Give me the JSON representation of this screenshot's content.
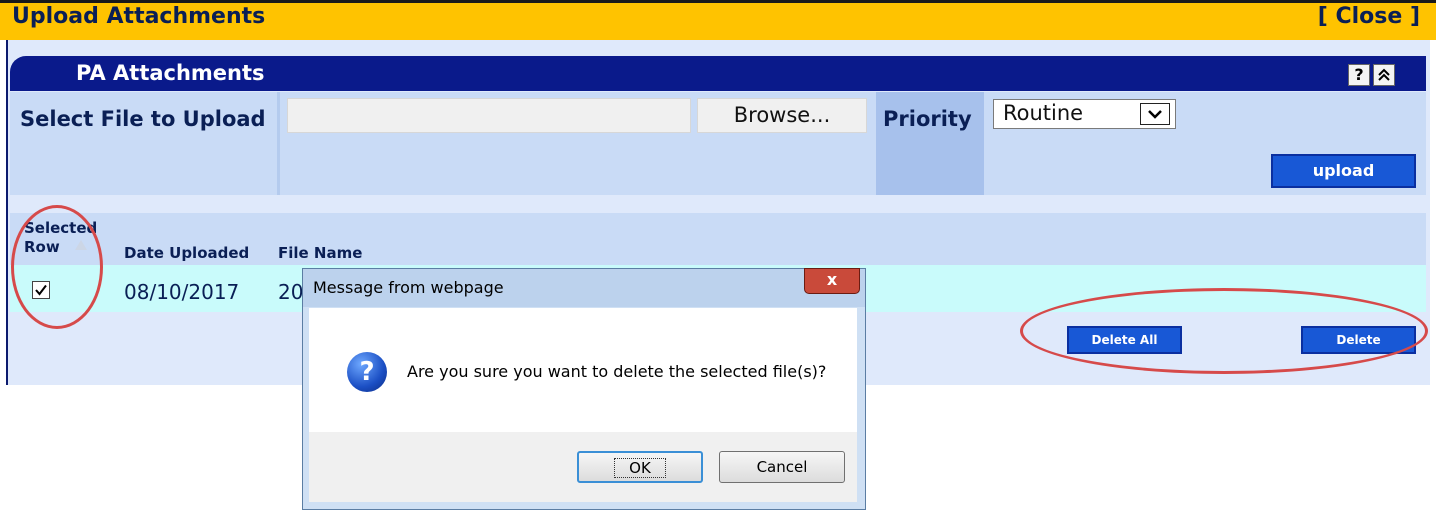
{
  "window": {
    "title": "Upload Attachments",
    "close_label": "[ Close ]"
  },
  "section": {
    "title": "PA Attachments",
    "help_label": "?",
    "collapse_label": "«"
  },
  "upload_form": {
    "file_label": "Select File to Upload",
    "file_value": "",
    "browse_label": "Browse...",
    "priority_label": "Priority",
    "priority_selected": "Routine",
    "upload_label": "upload"
  },
  "table": {
    "headers": {
      "selected_row": "Selected Row",
      "date_uploaded": "Date Uploaded",
      "file_name": "File Name"
    },
    "rows": [
      {
        "selected": true,
        "date_uploaded": "08/10/2017",
        "file_name": "20"
      }
    ]
  },
  "actions": {
    "delete_all_label": "Delete All",
    "delete_label": "Delete"
  },
  "dialog": {
    "title": "Message from webpage",
    "message": "Are you sure you want to delete the selected file(s)?",
    "ok_label": "OK",
    "cancel_label": "Cancel",
    "close_glyph": "x"
  },
  "colors": {
    "title_bar": "#ffc300",
    "section_header": "#0a1a8b",
    "action_button": "#1858d6",
    "annotation": "#d64a4a",
    "selected_row_bg": "#c9fbfb"
  }
}
